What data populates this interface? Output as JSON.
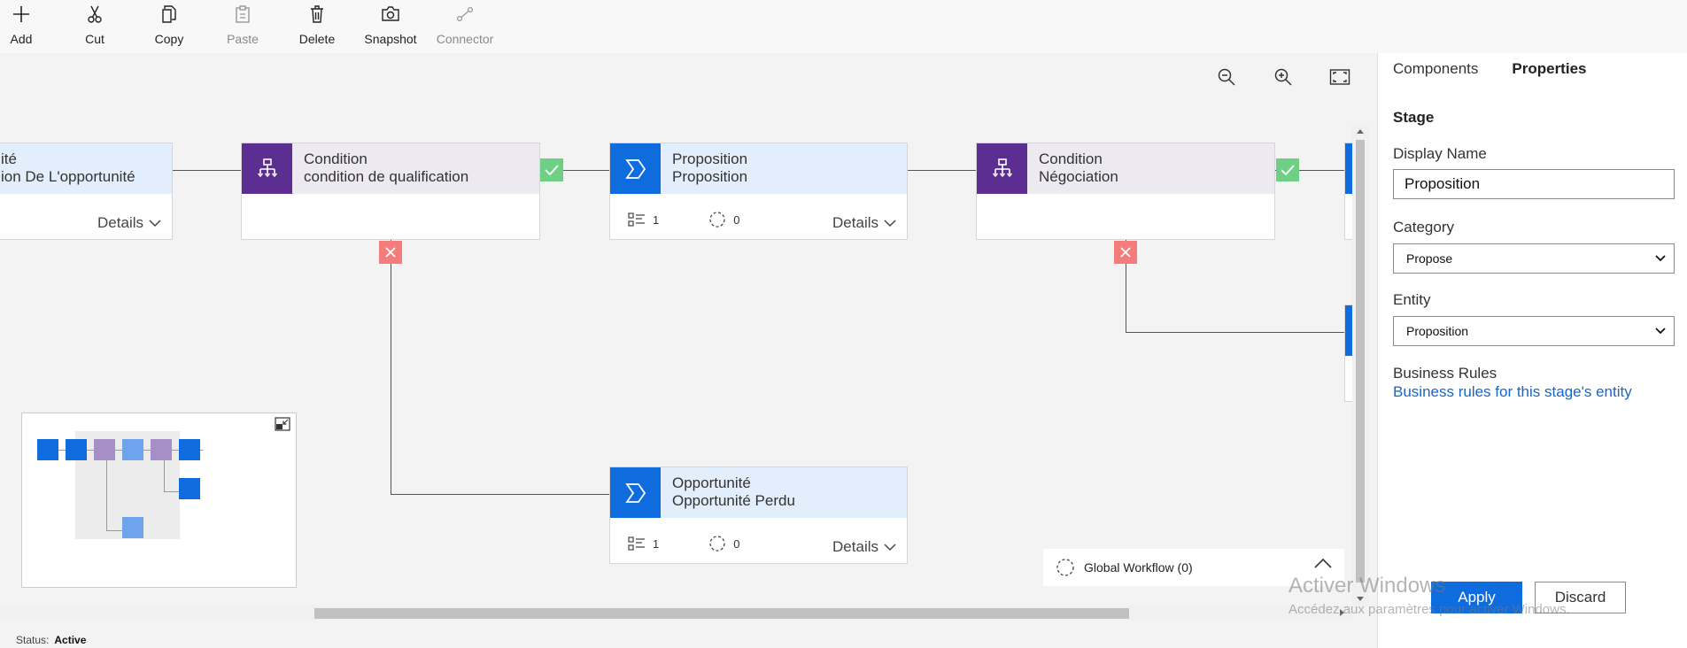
{
  "toolbar": {
    "items": [
      {
        "label": "Add",
        "icon": "plus-icon",
        "enabled": true
      },
      {
        "label": "Cut",
        "icon": "scissors-icon",
        "enabled": true
      },
      {
        "label": "Copy",
        "icon": "copy-icon",
        "enabled": true
      },
      {
        "label": "Paste",
        "icon": "paste-icon",
        "enabled": false
      },
      {
        "label": "Delete",
        "icon": "trash-icon",
        "enabled": true
      },
      {
        "label": "Snapshot",
        "icon": "camera-icon",
        "enabled": true
      },
      {
        "label": "Connector",
        "icon": "connector-icon",
        "enabled": false
      }
    ]
  },
  "canvas": {
    "zoom_controls": [
      "zoom-out-icon",
      "zoom-in-icon",
      "fit-to-screen-icon"
    ],
    "cards": {
      "partial_stage": {
        "title": "ité",
        "subtitle": "ion De L'opportunité",
        "details": "Details"
      },
      "condition_qualification": {
        "title": "Condition",
        "subtitle": "condition de qualification"
      },
      "proposition": {
        "title": "Proposition",
        "subtitle": "Proposition",
        "steps": "1",
        "workflows": "0",
        "details": "Details"
      },
      "condition_negociation": {
        "title": "Condition",
        "subtitle": "Négociation"
      },
      "opportunite_perdu": {
        "title": "Opportunité",
        "subtitle": "Opportunité Perdu",
        "steps": "1",
        "workflows": "0",
        "details": "Details"
      }
    },
    "global_workflow": "Global Workflow (0)"
  },
  "status": {
    "label": "Status:",
    "value": "Active"
  },
  "panel": {
    "tabs": [
      {
        "label": "Components",
        "active": false
      },
      {
        "label": "Properties",
        "active": true
      }
    ],
    "heading": "Stage",
    "display_name_label": "Display Name",
    "display_name_value": "Proposition",
    "category_label": "Category",
    "category_value": "Propose",
    "entity_label": "Entity",
    "entity_value": "Proposition",
    "business_rules_label": "Business Rules",
    "business_rules_link": "Business rules for this stage's entity",
    "apply_label": "Apply",
    "discard_label": "Discard"
  },
  "watermark": {
    "line1": "Activer Windows",
    "line2": "Accédez aux paramètres pour activer Windows."
  },
  "colors": {
    "stage_blue": "#0f6cde",
    "condition_purple": "#5c2e91",
    "yes_green": "#6fcf85",
    "no_red": "#f47c7c",
    "link_blue": "#1766c9"
  }
}
